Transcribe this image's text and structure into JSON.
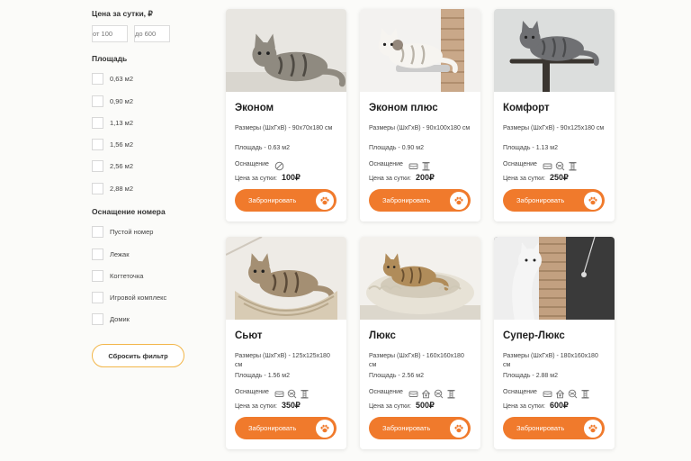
{
  "filters": {
    "price_title": "Цена за сутки, ₽",
    "price_from_placeholder": "от 100",
    "price_to_placeholder": "до 600",
    "area_title": "Площадь",
    "areas": [
      "0,63 м2",
      "0,90 м2",
      "1,13 м2",
      "1,56 м2",
      "2,56 м2",
      "2,88 м2"
    ],
    "equipment_title": "Оснащение номера",
    "equipment": [
      "Пустой номер",
      "Лежак",
      "Когтеточка",
      "Игровой комплекс",
      "Домик"
    ],
    "reset_label": "Сбросить фильтр"
  },
  "colors": {
    "accent": "#f07a2c",
    "reset_border": "#f2b64a"
  },
  "card_common": {
    "equip_label": "Оснащение",
    "price_label": "Цена за сутки:",
    "book_label": "Забронировать"
  },
  "rooms": [
    {
      "title": "Эконом",
      "size": "Размеры (ШхГхВ) - 90х70х180 см",
      "area": "Площадь - 0.63 м2",
      "price": "100₽",
      "icons": [
        "empty-icon"
      ],
      "photo": "cat-lying-photo"
    },
    {
      "title": "Эконом плюс",
      "size": "Размеры (ШхГхВ) - 90х100х180 см",
      "area": "Площадь - 0.90 м2",
      "price": "200₽",
      "icons": [
        "bed-icon",
        "scratching-post-icon"
      ],
      "photo": "cat-scratching-post-photo"
    },
    {
      "title": "Комфорт",
      "size": "Размеры (ШхГхВ) - 90х125х180 см",
      "area": "Площадь - 1.13 м2",
      "price": "250₽",
      "icons": [
        "bed-icon",
        "toy-ball-icon",
        "scratching-post-icon"
      ],
      "photo": "cat-on-tree-photo"
    },
    {
      "title": "Сьют",
      "size": "Размеры (ШхГхВ) - 125х125х180 см",
      "area": "Площадь - 1.56 м2",
      "price": "350₽",
      "icons": [
        "bed-icon",
        "toy-ball-icon",
        "scratching-post-icon"
      ],
      "photo": "cat-in-basket-photo"
    },
    {
      "title": "Люкс",
      "size": "Размеры (ШхГхВ) - 160х160х180 см",
      "area": "Площадь - 2.56 м2",
      "price": "500₽",
      "icons": [
        "bed-icon",
        "house-icon",
        "toy-ball-icon",
        "scratching-post-icon"
      ],
      "photo": "cat-in-fluffy-bed-photo"
    },
    {
      "title": "Супер-Люкс",
      "size": "Размеры (ШхГхВ) - 180х160х180 см",
      "area": "Площадь - 2.88 м2",
      "price": "600₽",
      "icons": [
        "bed-icon",
        "house-icon",
        "toy-ball-icon",
        "scratching-post-icon"
      ],
      "photo": "cat-playing-photo"
    }
  ]
}
